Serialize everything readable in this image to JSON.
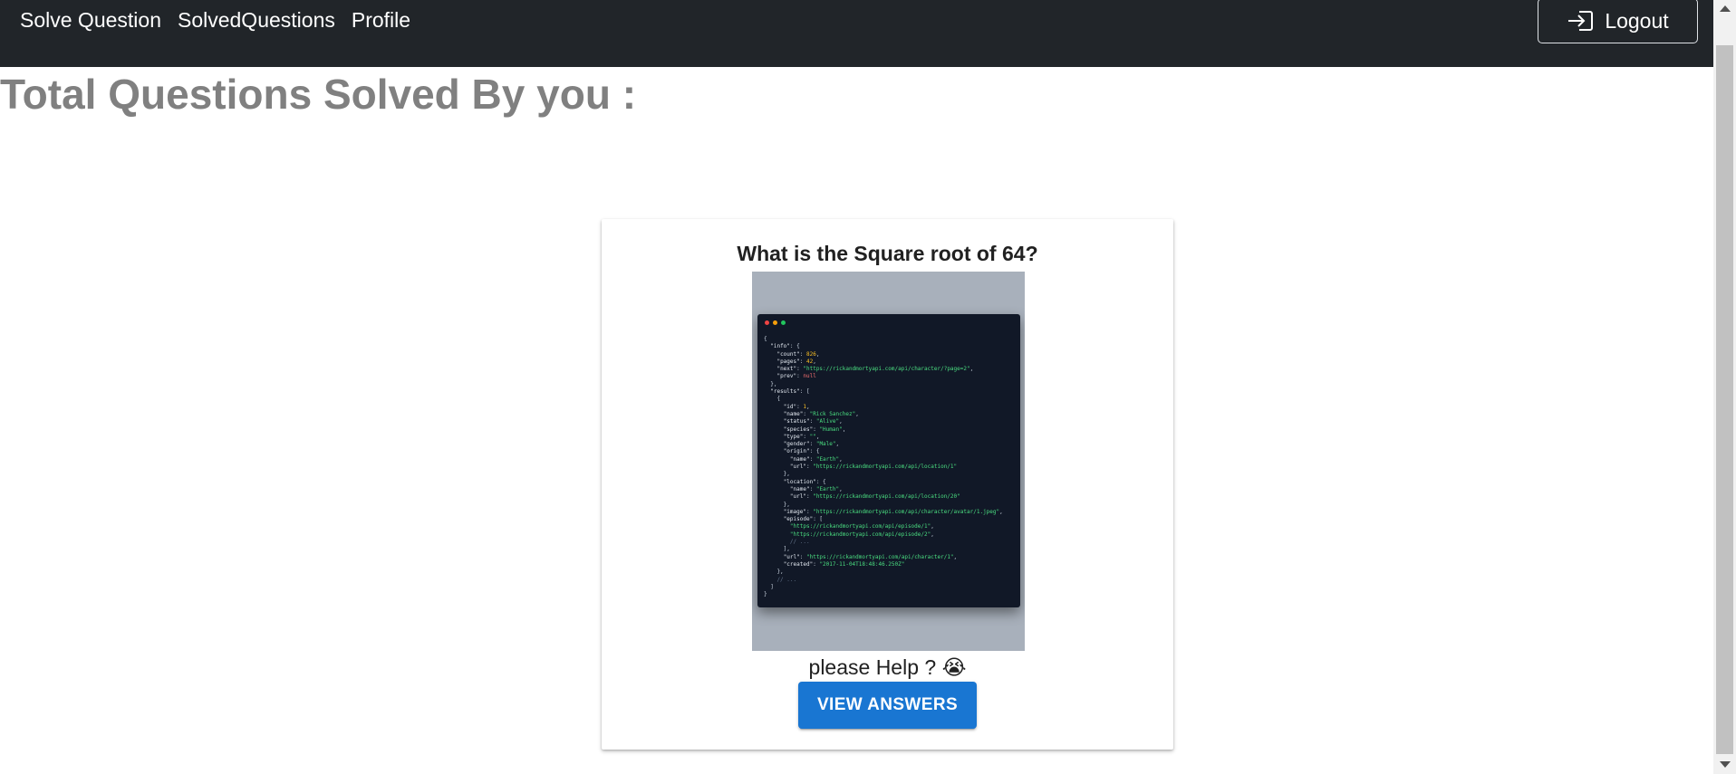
{
  "navbar": {
    "links": [
      "Solve Question",
      "SolvedQuestions",
      "Profile"
    ],
    "logout_label": "Logout",
    "logout_icon": "login-arrow-icon",
    "background": "#212529"
  },
  "heading": {
    "text": "Total Questions Solved By you :",
    "color": "#808080"
  },
  "question_card": {
    "title": "What is the Square root of 64?",
    "image_icon": "code-screenshot-image",
    "description": "please Help ? 😭",
    "button_label": "VIEW ANSWERS",
    "button_color": "#1976d2"
  },
  "code_image": {
    "lines": [
      "{",
      "  \"info\": {",
      "    \"count\": 826,",
      "    \"pages\": 42,",
      "    \"next\": \"https://rickandmortyapi.com/api/character/?page=2\",",
      "    \"prev\": null",
      "  },",
      "  \"results\": [",
      "    {",
      "      \"id\": 1,",
      "      \"name\": \"Rick Sanchez\",",
      "      \"status\": \"Alive\",",
      "      \"species\": \"Human\",",
      "      \"type\": \"\",",
      "      \"gender\": \"Male\",",
      "      \"origin\": {",
      "        \"name\": \"Earth\",",
      "        \"url\": \"https://rickandmortyapi.com/api/location/1\"",
      "      },",
      "      \"location\": {",
      "        \"name\": \"Earth\",",
      "        \"url\": \"https://rickandmortyapi.com/api/location/20\"",
      "      },",
      "      \"image\": \"https://rickandmortyapi.com/api/character/avatar/1.jpeg\",",
      "      \"episode\": [",
      "        \"https://rickandmortyapi.com/api/episode/1\",",
      "        \"https://rickandmortyapi.com/api/episode/2\",",
      "        // ...",
      "      ],",
      "      \"url\": \"https://rickandmortyapi.com/api/character/1\",",
      "      \"created\": \"2017-11-04T18:48:46.250Z\"",
      "    },",
      "    // ...",
      "  ]",
      "}"
    ]
  }
}
